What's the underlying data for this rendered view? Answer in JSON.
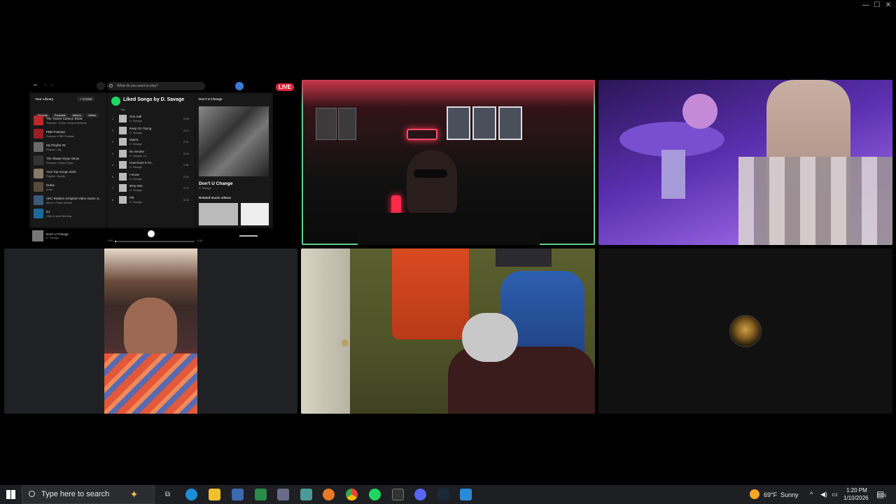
{
  "window": {
    "minimize_glyph": "—",
    "maximize_glyph": "☐",
    "close_glyph": "✕"
  },
  "badge": {
    "live": "LIVE"
  },
  "spotify": {
    "search_placeholder": "What do you want to play?",
    "library": {
      "title": "Your Library",
      "create": "+ Create",
      "filters": [
        "Playlists",
        "Podcasts",
        "Albums",
        "Artists"
      ],
      "items": [
        {
          "title": "The Tucker Carlson Show",
          "sub": "Podcast • Tucker Carlson Network",
          "color": "#c0272d"
        },
        {
          "title": "PBD Podcast",
          "sub": "Podcast • PBD Podcast",
          "color": "#9a1e22"
        },
        {
          "title": "My Playlist #6",
          "sub": "Playlist • Jay",
          "color": "#6b6b6b"
        },
        {
          "title": "The Shawn Ryan Show",
          "sub": "Podcast • Shawn Ryan",
          "color": "#333"
        },
        {
          "title": "Your Top Songs 2025",
          "sub": "Playlist • Spotify",
          "color": "#8a7a6a"
        },
        {
          "title": "Drake",
          "sub": "Artist",
          "color": "#5a4a3a"
        },
        {
          "title": "ARC Raiders (Original Video Game S...",
          "sub": "Album • Pablo Andrés",
          "color": "#3a5a7a"
        },
        {
          "title": "DJ",
          "sub": "Click to start listening",
          "color": "#1a6a9a"
        }
      ]
    },
    "playlist": {
      "title": "Liked Songs by D. Savage",
      "col_title": "Title",
      "songs": [
        {
          "n": "1",
          "title": "One Kall",
          "artist": "D. Savage",
          "dur": "2:06"
        },
        {
          "n": "2",
          "title": "Keep On Trying",
          "artist": "D. Savage",
          "dur": "2:07"
        },
        {
          "n": "3",
          "title": "Opera",
          "artist": "D. Savage",
          "dur": "2:11"
        },
        {
          "n": "4",
          "title": "No Smoke",
          "artist": "D. Savage, Lil...",
          "dur": "2:00"
        },
        {
          "n": "5",
          "title": "How Does It Fe...",
          "artist": "D. Savage",
          "dur": "2:30"
        },
        {
          "n": "6",
          "title": "I Know",
          "artist": "D. Savage",
          "dur": "2:22"
        },
        {
          "n": "7",
          "title": "Dirty Dan",
          "artist": "D. Savage",
          "dur": "2:27"
        },
        {
          "n": "8",
          "title": "Pill",
          "artist": "D. Savage",
          "dur": "3:33"
        }
      ]
    },
    "now_playing_panel": {
      "header": "Don't U Change",
      "title": "Don't U Change",
      "artist": "D. Savage",
      "related": "Related music videos"
    },
    "player": {
      "track": "Don't U Change",
      "artist": "D. Savage",
      "elapsed": "0:05",
      "total": "4:16",
      "progress": 0.02
    }
  },
  "taskbar": {
    "search_placeholder": "Type here to search",
    "weather_temp": "69°F",
    "weather_cond": "Sunny",
    "time": "1:20 PM",
    "date": "1/10/2026",
    "notification_count": "5"
  }
}
